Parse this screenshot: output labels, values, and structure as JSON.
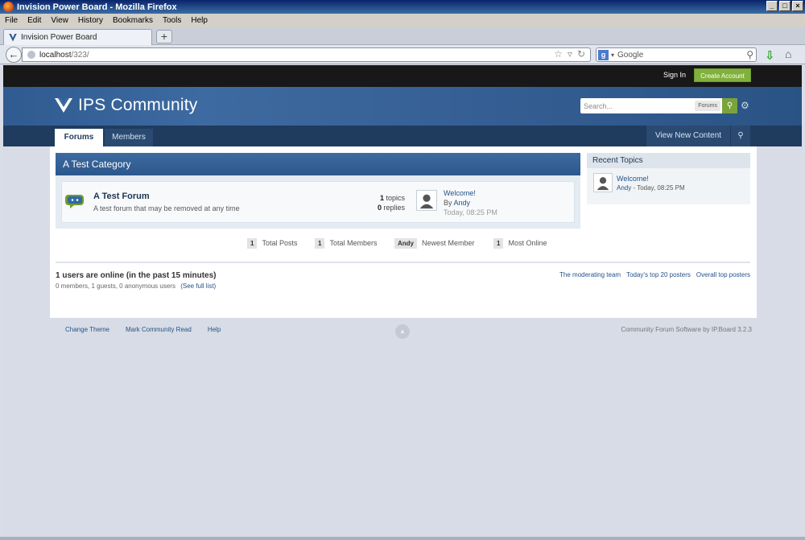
{
  "window": {
    "title": "Invision Power Board - Mozilla Firefox",
    "buttons": [
      "_",
      "□",
      "×"
    ]
  },
  "menu": [
    "File",
    "Edit",
    "View",
    "History",
    "Bookmarks",
    "Tools",
    "Help"
  ],
  "browser": {
    "tab_title": "Invision Power Board",
    "new_tab": "+",
    "url_host": "localhost",
    "url_path": "/323/",
    "search_placeholder": "Google",
    "search_engine_badge": "g"
  },
  "userbar": {
    "sign_in": "Sign In",
    "create_account": "Create Account"
  },
  "branding": {
    "site_name": "IPS Community",
    "search_placeholder": "Search...",
    "search_scope": "Forums"
  },
  "nav": {
    "tabs": [
      {
        "label": "Forums",
        "active": true
      },
      {
        "label": "Members",
        "active": false
      }
    ],
    "view_new_content": "View New Content"
  },
  "category": {
    "title": "A Test Category",
    "forums": [
      {
        "title": "A Test Forum",
        "description": "A test forum that may be removed at any time",
        "topics_count": "1",
        "topics_label": "topics",
        "replies_count": "0",
        "replies_label": "replies",
        "last_post_title": "Welcome!",
        "last_post_by_prefix": "By",
        "last_post_author": "Andy",
        "last_post_time": "Today, 08:25 PM"
      }
    ]
  },
  "recent_topics": {
    "title": "Recent Topics",
    "items": [
      {
        "title": "Welcome!",
        "author": "Andy",
        "meta": " - Today, 08:25 PM"
      }
    ]
  },
  "board_stats": [
    {
      "value": "1",
      "label": "Total Posts"
    },
    {
      "value": "1",
      "label": "Total Members"
    },
    {
      "value": "Andy",
      "label": "Newest Member"
    },
    {
      "value": "1",
      "label": "Most Online"
    }
  ],
  "online": {
    "title": "1 users are online (in the past 15 minutes)",
    "summary": "0 members, 1 guests, 0 anonymous users",
    "full_list_link": "(See full list)",
    "links": [
      "The moderating team",
      "Today's top 20 posters",
      "Overall top posters"
    ]
  },
  "footer": {
    "links": [
      "Change Theme",
      "Mark Community Read",
      "Help"
    ],
    "back_to_top": "▲",
    "copyright": "Community Forum Software by IP.Board 3.2.3"
  },
  "colors": {
    "brand_blue": "#3d6aa0",
    "nav_dark": "#1f3b5e",
    "accent_green": "#80b13b",
    "link": "#245389"
  }
}
